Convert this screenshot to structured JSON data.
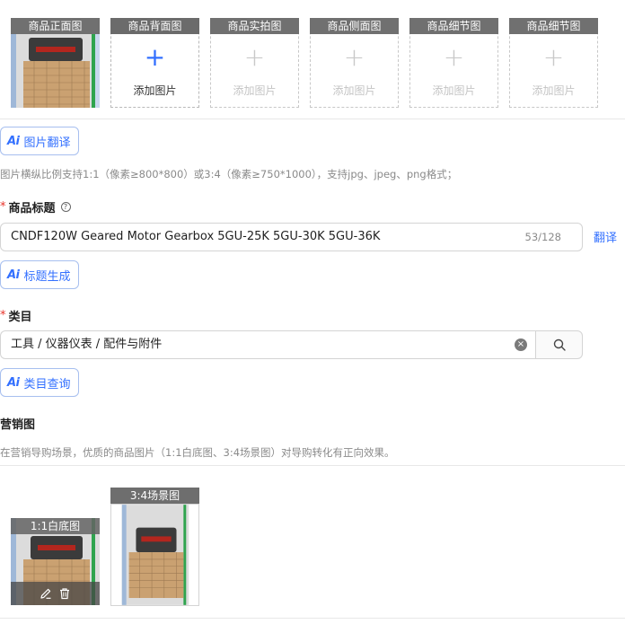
{
  "image_slots": [
    {
      "caption": "商品正面图",
      "filled": true
    },
    {
      "caption": "商品背面图",
      "filled": false,
      "add_label": "添加图片",
      "active": true
    },
    {
      "caption": "商品实拍图",
      "filled": false,
      "add_label": "添加图片"
    },
    {
      "caption": "商品侧面图",
      "filled": false,
      "add_label": "添加图片"
    },
    {
      "caption": "商品细节图",
      "filled": false,
      "add_label": "添加图片"
    },
    {
      "caption": "商品细节图",
      "filled": false,
      "add_label": "添加图片"
    }
  ],
  "ai_image_translate": {
    "icon": "Ai",
    "label": "图片翻译"
  },
  "image_hint": "图片横纵比例支持1:1（像素≥800*800）或3:4（像素≥750*1000），支持jpg、jpeg、png格式；",
  "title_field": {
    "required_mark": "*",
    "label": "商品标题",
    "help_icon": "?",
    "value": "CNDF120W Geared Motor Gearbox 5GU-25K 5GU-30K 5GU-36K",
    "count": "53/128",
    "translate_label": "翻译"
  },
  "ai_title_generate": {
    "icon": "Ai",
    "label": "标题生成"
  },
  "category_field": {
    "required_mark": "*",
    "label": "类目",
    "value": "工具 / 仪器仪表 / 配件与附件",
    "clear_icon": "×"
  },
  "ai_category_query": {
    "icon": "Ai",
    "label": "类目查询"
  },
  "marketing": {
    "label": "营销图",
    "hint": "在营销导购场景，优质的商品图片（1:1白底图、3:4场景图）对导购转化有正向效果。",
    "slots": [
      {
        "caption": "1:1白底图"
      },
      {
        "caption": "3:4场景图"
      }
    ]
  },
  "colors": {
    "accent": "#3370ff",
    "required": "#e8342b",
    "caption_bg": "#707070"
  }
}
